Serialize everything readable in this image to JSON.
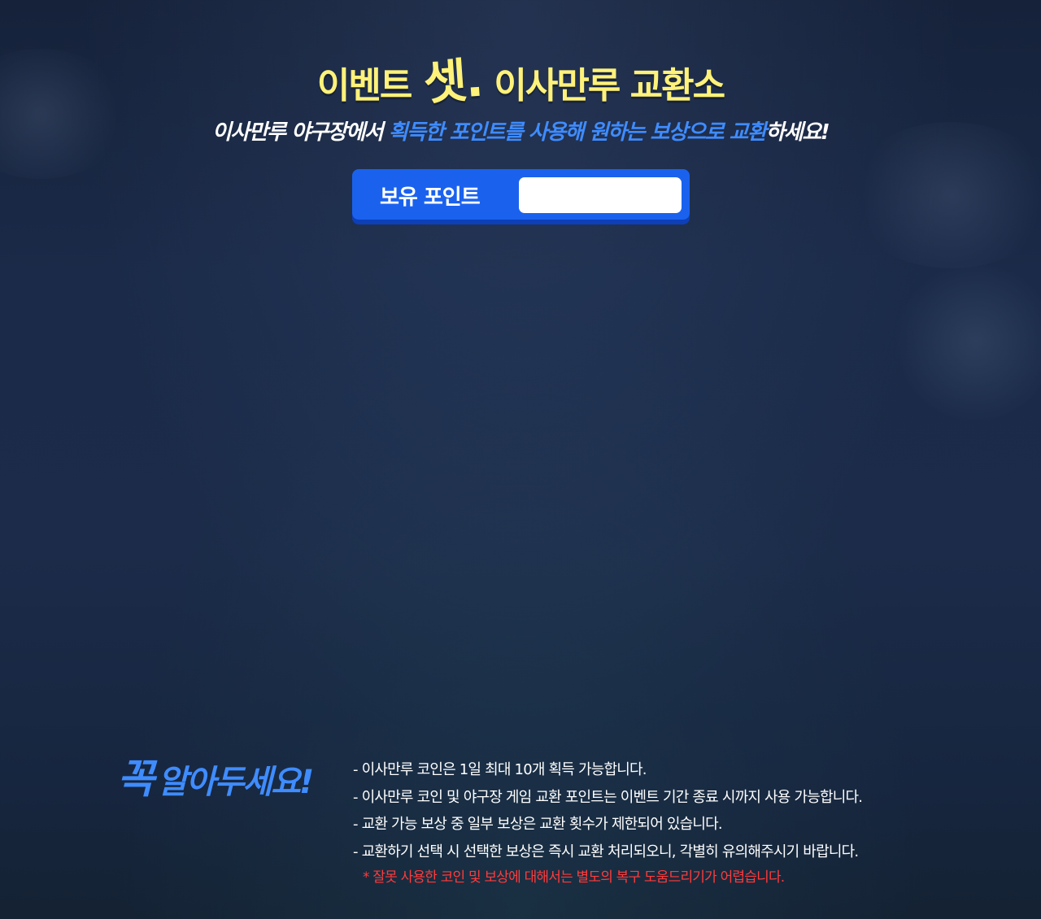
{
  "header": {
    "title_prefix": "이벤트",
    "title_emphasis": "셋.",
    "title_suffix": "이사만루 교환소",
    "subtitle_start": "이사만루 야구장에서",
    "subtitle_highlight1": "획득한 포인트를 사용해 원하는 보상으로 교환",
    "subtitle_end": "하세요!"
  },
  "points": {
    "label": "보유 포인트",
    "value": ""
  },
  "notice": {
    "title_big": "꼭",
    "title_rest": "알아두세요!",
    "items": [
      "- 이사만루 코인은 1일 최대 10개 획득 가능합니다.",
      "- 이사만루 코인 및 야구장 게임 교환 포인트는 이벤트 기간 종료 시까지 사용 가능합니다.",
      "- 교환 가능 보상 중 일부 보상은 교환 횟수가 제한되어 있습니다.",
      "- 교환하기 선택 시 선택한 보상은 즉시 교환 처리되오니, 각별히 유의해주시기 바랍니다."
    ],
    "warning": "* 잘못 사용한 코인 및 보상에 대해서는 별도의 복구 도움드리기가 어렵습니다."
  },
  "colors": {
    "title_yellow": "#fff27a",
    "highlight_blue": "#3f8cff",
    "button_blue": "#1a62ee",
    "warning_red": "#ff3b3b",
    "background_navy": "#1b2b49"
  }
}
